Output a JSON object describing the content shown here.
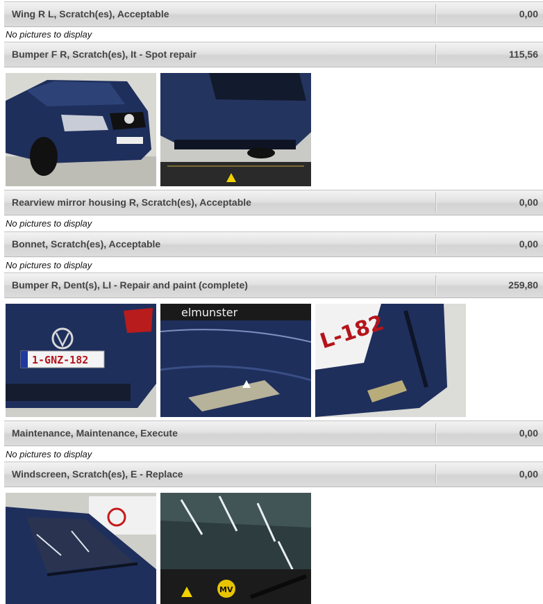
{
  "no_pictures_text": "No pictures to display",
  "items": [
    {
      "description": "Wing R L, Scratch(es), Acceptable",
      "amount": "0,00"
    },
    {
      "description": "Bumper F R, Scratch(es), It - Spot repair",
      "amount": "115,56"
    },
    {
      "description": "Rearview mirror housing R, Scratch(es), Acceptable",
      "amount": "0,00"
    },
    {
      "description": "Bonnet, Scratch(es), Acceptable",
      "amount": "0,00"
    },
    {
      "description": "Bumper R, Dent(s), LI - Repair and paint (complete)",
      "amount": "259,80"
    },
    {
      "description": "Maintenance, Maintenance, Execute",
      "amount": "0,00"
    },
    {
      "description": "Windscreen, Scratch(es), E - Replace",
      "amount": "0,00"
    }
  ],
  "photos": {
    "bumper_front_1": "car-front-photo",
    "bumper_front_2": "bumper-underside-photo",
    "bumper_rear_plate_text": "1-GNZ-182",
    "bumper_rear_1": "car-rear-photo",
    "bumper_rear_2_text": "elmunster",
    "bumper_rear_2": "rear-bumper-closeup-photo",
    "bumper_rear_3_text": "L-182",
    "bumper_rear_3": "rear-bumper-side-photo",
    "windscreen_1": "windscreen-photo",
    "windscreen_2": "windscreen-closeup-photo",
    "windscreen_2_text": "MV"
  },
  "colors": {
    "car_blue": "#1f2f5c",
    "row_text": "#444444"
  }
}
